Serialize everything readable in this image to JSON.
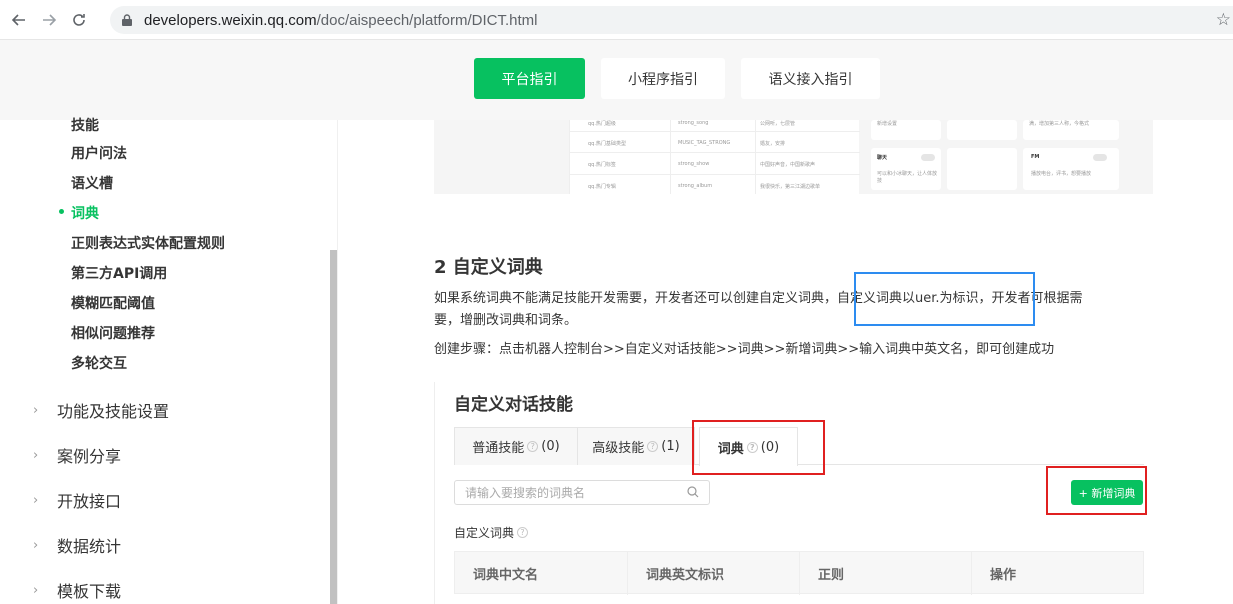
{
  "browser": {
    "url_host": "developers.weixin.qq.com",
    "url_path": "/doc/aispeech/platform/DICT.html"
  },
  "topnav": {
    "tabs": [
      {
        "label": "平台指引",
        "active": true
      },
      {
        "label": "小程序指引",
        "active": false
      },
      {
        "label": "语义接入指引",
        "active": false
      }
    ]
  },
  "sidebar": {
    "sub_items": [
      "技能",
      "用户问法",
      "语义槽",
      "词典",
      "正则表达式实体配置规则",
      "第三方API调用",
      "模糊匹配阈值",
      "相似问题推荐",
      "多轮交互"
    ],
    "active_item": "词典",
    "groups": [
      "功能及技能设置",
      "案例分享",
      "开放接口",
      "数据统计",
      "模板下载"
    ]
  },
  "image_strip": {
    "rows": [
      [
        "qq.热门超级",
        "strong_song",
        "公网听，七层管"
      ],
      [
        "qq.热门基础类型",
        "MUSIC_TAG_STRONG",
        "婚友，安排"
      ],
      [
        "qq.热门标签",
        "strong_show",
        "中国好声音，中国新歌声"
      ],
      [
        "qq.热门专辑",
        "strong_album",
        "我很快乐，第三江湖边歌单"
      ]
    ],
    "cards": [
      {
        "title": "新增设置",
        "desc": "满，增加第三人称，今格式"
      },
      {
        "title": "聊天",
        "desc": "可以和小冰聊天，让人体放技"
      },
      {
        "title": "FM",
        "desc": "播放电台，评书，想要播放"
      }
    ]
  },
  "content": {
    "section_title": "2 自定义词典",
    "para1_line1": "如果系统词典不能满足技能开发需要，开发者还可以创建自定义词典，自定义词典以uer.为标识，开发者可根据需",
    "para1_line2": "要，增删改词典和词条。",
    "para2": "创建步骤：点击机器人控制台>>自定义对话技能>>词典>>新增词典>>输入词典中英文名，即可创建成功"
  },
  "panel": {
    "title": "自定义对话技能",
    "tabs": [
      {
        "label": "普通技能",
        "count": "(0)"
      },
      {
        "label": "高级技能",
        "count": "(1)"
      },
      {
        "label": "词典",
        "count": "(0)"
      }
    ],
    "search_placeholder": "请输入要搜索的词典名",
    "add_button": "+ 新增词典",
    "sub_label": "自定义词典",
    "columns": [
      "词典中文名",
      "词典英文标识",
      "正则",
      "操作"
    ]
  },
  "colors": {
    "brand_green": "#07c160",
    "highlight_blue": "#2d8cf0",
    "annotation_red": "#e02020"
  }
}
